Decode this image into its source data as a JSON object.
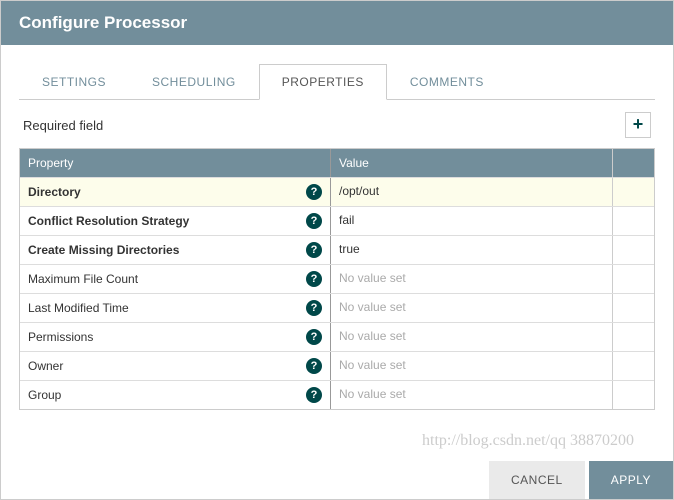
{
  "header": {
    "title": "Configure Processor"
  },
  "tabs": [
    {
      "label": "SETTINGS",
      "active": false
    },
    {
      "label": "SCHEDULING",
      "active": false
    },
    {
      "label": "PROPERTIES",
      "active": true
    },
    {
      "label": "COMMENTS",
      "active": false
    }
  ],
  "required_label": "Required field",
  "table": {
    "headers": {
      "property": "Property",
      "value": "Value"
    },
    "rows": [
      {
        "name": "Directory",
        "bold": true,
        "value": "/opt/out",
        "empty": false,
        "highlight": true
      },
      {
        "name": "Conflict Resolution Strategy",
        "bold": true,
        "value": "fail",
        "empty": false,
        "highlight": false
      },
      {
        "name": "Create Missing Directories",
        "bold": true,
        "value": "true",
        "empty": false,
        "highlight": false
      },
      {
        "name": "Maximum File Count",
        "bold": false,
        "value": "No value set",
        "empty": true,
        "highlight": false
      },
      {
        "name": "Last Modified Time",
        "bold": false,
        "value": "No value set",
        "empty": true,
        "highlight": false
      },
      {
        "name": "Permissions",
        "bold": false,
        "value": "No value set",
        "empty": true,
        "highlight": false
      },
      {
        "name": "Owner",
        "bold": false,
        "value": "No value set",
        "empty": true,
        "highlight": false
      },
      {
        "name": "Group",
        "bold": false,
        "value": "No value set",
        "empty": true,
        "highlight": false
      }
    ]
  },
  "footer": {
    "cancel": "CANCEL",
    "apply": "APPLY"
  },
  "watermark": "http://blog.csdn.net/qq 38870200"
}
